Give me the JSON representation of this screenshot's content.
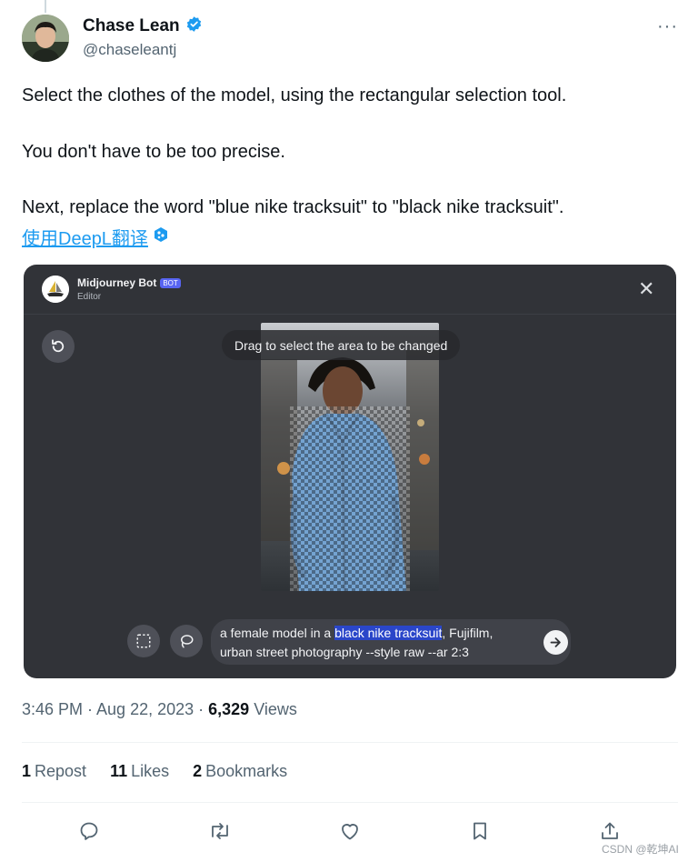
{
  "author": {
    "name": "Chase Lean",
    "handle": "@chaseleantj",
    "verified": true
  },
  "tweet": {
    "line1": "Select the clothes of the model, using the rectangular selection tool.",
    "line2": "You don't have to be too precise.",
    "line3": "Next, replace the word \"blue nike tracksuit\" to \"black nike tracksuit\".",
    "translate_label": "使用DeepL翻译"
  },
  "media": {
    "bot_name": "Midjourney Bot",
    "bot_badge": "BOT",
    "subtitle": "Editor",
    "hint": "Drag to select the area to be changed",
    "prompt_before": "a female model in a ",
    "prompt_highlight": "black nike tracksuit",
    "prompt_after": ", Fujifilm, urban street photography --style raw --ar 2:3",
    "colors": {
      "panel_bg": "#313338",
      "highlight": "#2a46c9",
      "jacket": "#3f7fbf"
    }
  },
  "meta": {
    "time": "3:46 PM · Aug 22, 2023 · ",
    "views_count": "6,329",
    "views_label": " Views"
  },
  "stats": {
    "reposts_count": "1",
    "reposts_label": "Repost",
    "likes_count": "11",
    "likes_label": "Likes",
    "bookmarks_count": "2",
    "bookmarks_label": "Bookmarks"
  },
  "actions": [
    "reply-icon",
    "repost-icon",
    "like-icon",
    "bookmark-icon",
    "share-icon"
  ],
  "watermark": "CSDN @乾坤AI",
  "accent_color": "#1d9bf0"
}
